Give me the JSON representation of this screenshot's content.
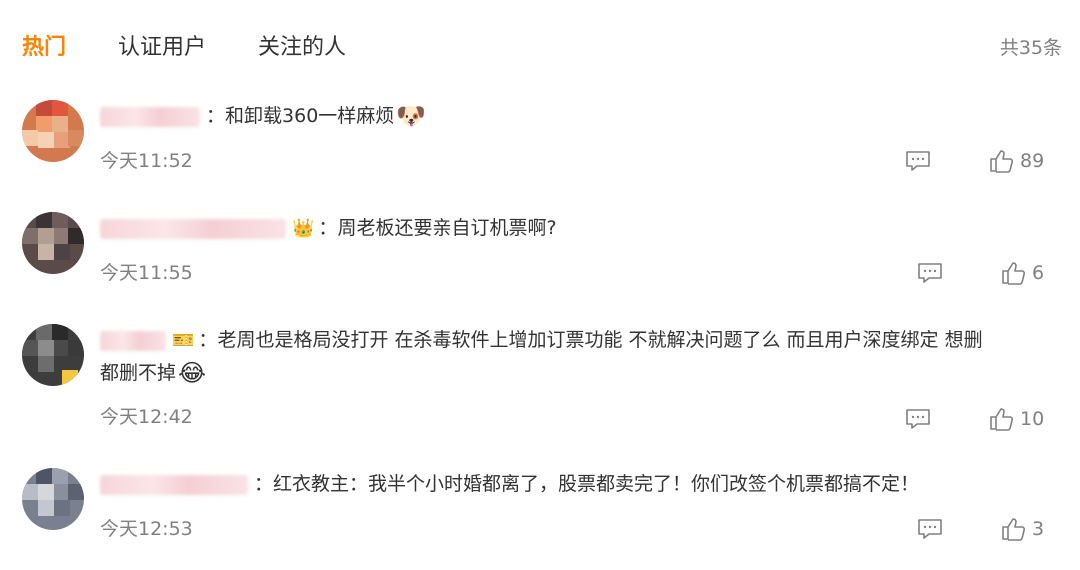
{
  "tabs": [
    {
      "label": "热门"
    },
    {
      "label": "认证用户"
    },
    {
      "label": "关注的人"
    }
  ],
  "total_label": "共35条",
  "colors": {
    "accent": "#ff8200",
    "text": "#333333",
    "muted": "#808080"
  },
  "comments": [
    {
      "separator": "：",
      "text": "和卸载360一样麻烦",
      "emoji": "🐶",
      "time": "今天11:52",
      "likes": "89"
    },
    {
      "badge": "👑",
      "separator": "：",
      "text": "周老板还要亲自订机票啊?",
      "time": "今天11:55",
      "likes": "6"
    },
    {
      "badge": "🎫",
      "separator": "：",
      "text": "老周也是格局没打开 在杀毒软件上增加订票功能 不就解决问题了么 而且用户深度绑定 想删",
      "text_2": "都删不掉",
      "emoji": "😂",
      "time": "今天12:42",
      "likes": "10"
    },
    {
      "separator": "：",
      "text": "红衣教主：我半个小时婚都离了，股票都卖完了！你们改签个机票都搞不定！",
      "time": "今天12:53",
      "likes": "3"
    }
  ]
}
